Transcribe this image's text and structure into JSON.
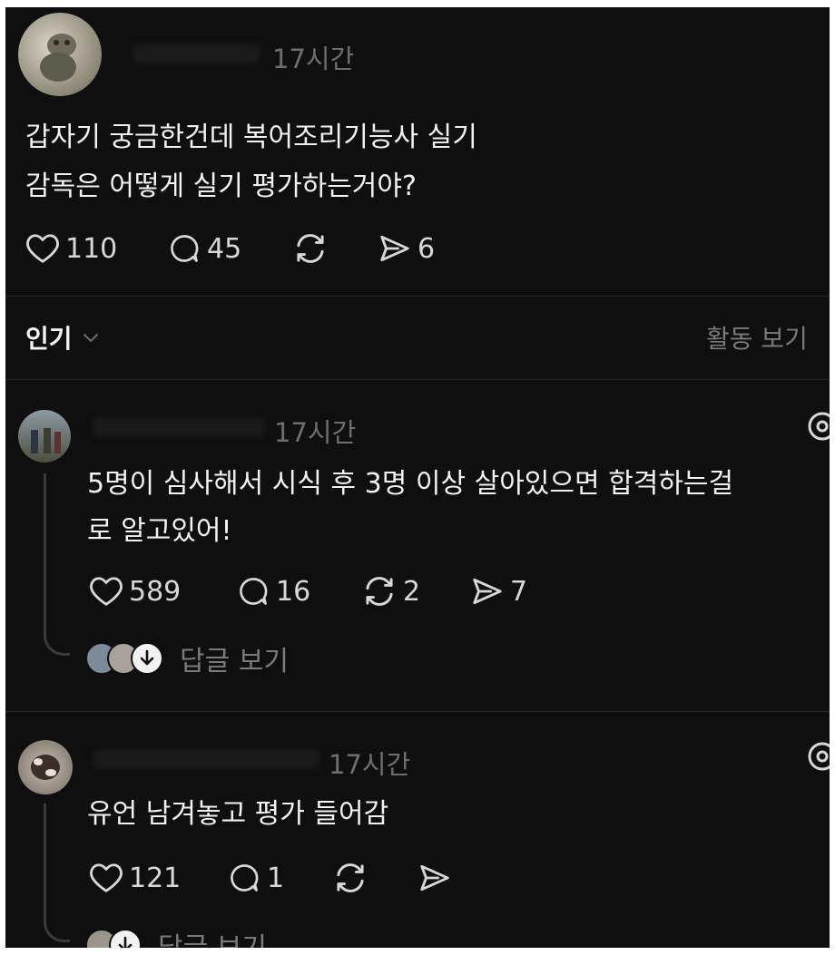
{
  "post": {
    "time": "17시간",
    "text_line1": "갑자기 궁금한건데 복어조리기능사 실기",
    "text_line2": "감독은 어떻게 실기 평가하는거야?",
    "likes": "110",
    "comments": "45",
    "shares": "6"
  },
  "sort": {
    "label": "인기",
    "activity_link": "활동 보기"
  },
  "replies": [
    {
      "time": "17시간",
      "text_line1": "5명이 심사해서 시식 후 3명 이상 살아있으면 합격하는걸",
      "text_line2": "로 알고있어!",
      "likes": "589",
      "comments": "16",
      "reposts": "2",
      "shares": "7",
      "view_replies": "답글 보기"
    },
    {
      "time": "17시간",
      "text_line1": "유언 남겨놓고 평가 들어감",
      "likes": "121",
      "comments": "1",
      "view_replies": "답글 보기"
    }
  ],
  "colors": {
    "background": "#0f0f0f",
    "text": "#f2f2f2",
    "muted": "#6e6e6e"
  },
  "icons": [
    "heart-icon",
    "comment-icon",
    "repost-icon",
    "send-icon",
    "chevron-down-icon",
    "arrow-down-icon",
    "more-icon"
  ]
}
